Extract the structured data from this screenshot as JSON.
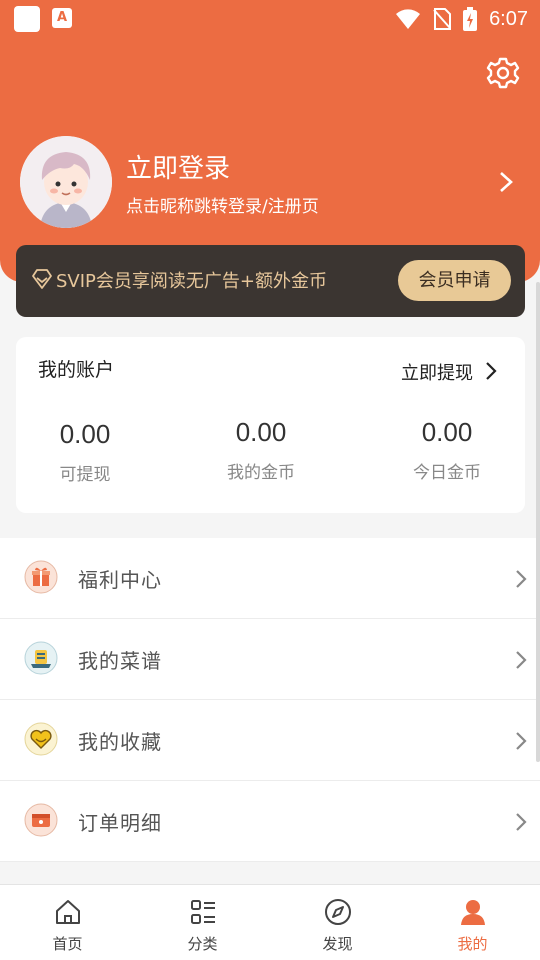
{
  "colors": {
    "accent": "#ec6c42",
    "vip_bg": "#3b3531",
    "vip_gold": "#e8c996"
  },
  "status_bar": {
    "app_icon_letter": "A",
    "time": "6:07"
  },
  "header": {
    "login_title": "立即登录",
    "login_subtitle": "点击昵称跳转登录/注册页"
  },
  "vip": {
    "text": "SVIP会员享阅读无广告+额外金币",
    "button": "会员申请"
  },
  "account": {
    "title": "我的账户",
    "withdraw_link": "立即提现",
    "stats": [
      {
        "value": "0.00",
        "label": "可提现"
      },
      {
        "value": "0.00",
        "label": "我的金币"
      },
      {
        "value": "0.00",
        "label": "今日金币"
      }
    ]
  },
  "menu": [
    {
      "label": "福利中心",
      "icon": "gift-icon"
    },
    {
      "label": "我的菜谱",
      "icon": "recipe-icon"
    },
    {
      "label": "我的收藏",
      "icon": "heart-icon"
    },
    {
      "label": "订单明细",
      "icon": "order-icon"
    }
  ],
  "tabs": [
    {
      "label": "首页",
      "icon": "home-icon"
    },
    {
      "label": "分类",
      "icon": "category-icon"
    },
    {
      "label": "发现",
      "icon": "compass-icon"
    },
    {
      "label": "我的",
      "icon": "user-icon",
      "active": true
    }
  ]
}
